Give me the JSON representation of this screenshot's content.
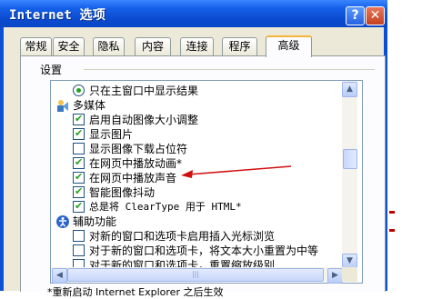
{
  "window": {
    "title": "Internet 选项",
    "help_label": "?",
    "close_label": "✕"
  },
  "tabs": [
    "常规",
    "安全",
    "隐私",
    "内容",
    "连接",
    "程序",
    "高级"
  ],
  "active_tab": "高级",
  "settings": {
    "group_label": "设置",
    "items": [
      {
        "kind": "radio",
        "label": "只在主窗口中显示结果",
        "selected": true
      },
      {
        "kind": "category",
        "label": "多媒体",
        "icon": "multimedia-icon"
      },
      {
        "kind": "checkbox",
        "label": "启用自动图像大小调整",
        "checked": true
      },
      {
        "kind": "checkbox",
        "label": "显示图片",
        "checked": true
      },
      {
        "kind": "checkbox",
        "label": "显示图像下载占位符",
        "checked": false
      },
      {
        "kind": "checkbox",
        "label": "在网页中播放动画*",
        "checked": true
      },
      {
        "kind": "checkbox",
        "label": "在网页中播放声音",
        "checked": true
      },
      {
        "kind": "checkbox",
        "label": "智能图像抖动",
        "checked": true
      },
      {
        "kind": "checkbox",
        "label": "总是将 ClearType 用于 HTML*",
        "checked": true
      },
      {
        "kind": "category",
        "label": "辅助功能",
        "icon": "accessibility-icon"
      },
      {
        "kind": "checkbox",
        "label": "对新的窗口和选项卡启用插入光标浏览",
        "checked": false
      },
      {
        "kind": "checkbox",
        "label": "对于新的窗口和选项卡，将文本大小重置为中等",
        "checked": false
      },
      {
        "kind": "checkbox",
        "label": "对于新的窗口和选项卡，重置缩放级别",
        "checked": false
      }
    ]
  },
  "scrollbar": {
    "grip": "|||"
  },
  "footnote": "*重新启动 Internet Explorer 之后生效",
  "colors": {
    "titlebar": "#0a4fd6",
    "dialog_bg": "#ece9d8",
    "check_green": "#21a121",
    "annotation_red": "#d01010"
  }
}
